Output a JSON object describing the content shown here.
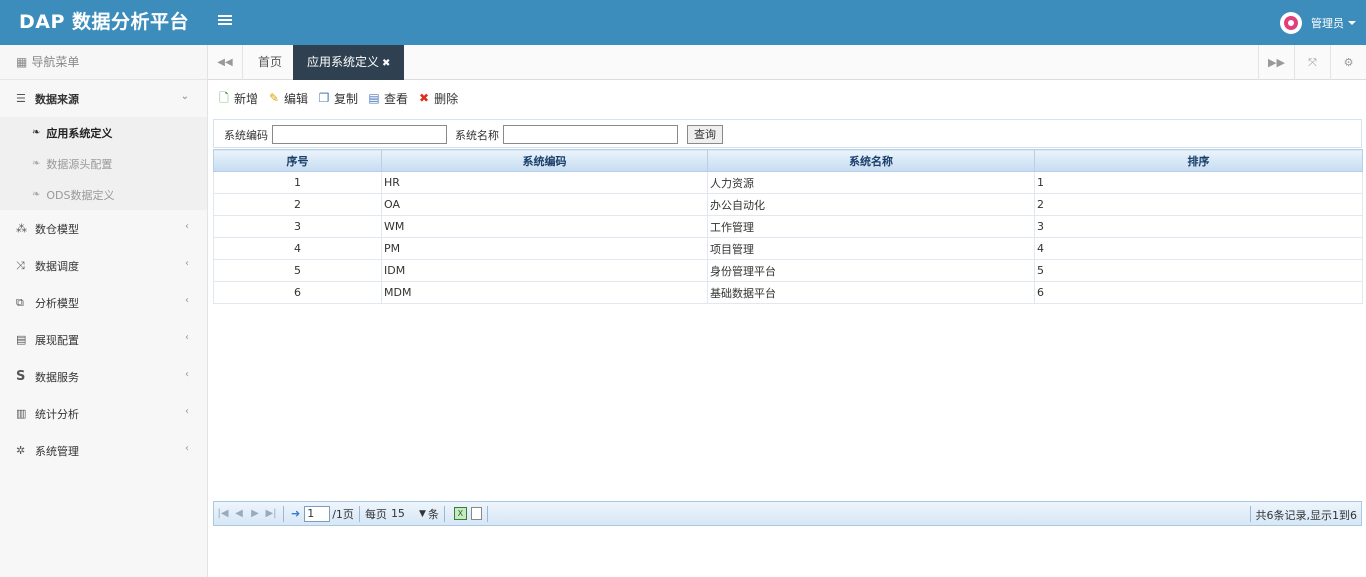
{
  "header": {
    "brand": "DAP 数据分析平台",
    "user_name": "管理员"
  },
  "sidebar": {
    "nav_title": "导航菜单",
    "menus": [
      {
        "label": "数据来源",
        "icon": "database-icon",
        "open": true,
        "children": [
          {
            "label": "应用系统定义",
            "active": true
          },
          {
            "label": "数据源头配置",
            "active": false
          },
          {
            "label": "ODS数据定义",
            "active": false
          }
        ]
      },
      {
        "label": "数仓模型",
        "icon": "cubes-icon"
      },
      {
        "label": "数据调度",
        "icon": "random-icon"
      },
      {
        "label": "分析模型",
        "icon": "object-group-icon"
      },
      {
        "label": "展现配置",
        "icon": "film-icon"
      },
      {
        "label": "数据服务",
        "icon": "s-icon"
      },
      {
        "label": "统计分析",
        "icon": "bar-chart-icon"
      },
      {
        "label": "系统管理",
        "icon": "gear-icon"
      }
    ]
  },
  "tabs": {
    "items": [
      {
        "label": "首页",
        "active": false
      },
      {
        "label": "应用系统定义",
        "active": true
      }
    ]
  },
  "toolbar": {
    "add": "新增",
    "edit": "编辑",
    "copy": "复制",
    "view": "查看",
    "delete": "删除"
  },
  "search": {
    "code_label": "系统编码",
    "code_value": "",
    "name_label": "系统名称",
    "name_value": "",
    "query_label": "查询"
  },
  "grid": {
    "columns": [
      "序号",
      "系统编码",
      "系统名称",
      "排序"
    ],
    "rows": [
      [
        "1",
        "HR",
        "人力资源",
        "1"
      ],
      [
        "2",
        "OA",
        "办公自动化",
        "2"
      ],
      [
        "3",
        "WM",
        "工作管理",
        "3"
      ],
      [
        "4",
        "PM",
        "项目管理",
        "4"
      ],
      [
        "5",
        "IDM",
        "身份管理平台",
        "5"
      ],
      [
        "6",
        "MDM",
        "基础数据平台",
        "6"
      ]
    ]
  },
  "pager": {
    "page": "1",
    "page_total": "/1页",
    "per_page_label": "每页",
    "per_page": "15",
    "unit": "条",
    "summary": "共6条记录,显示1到6"
  }
}
